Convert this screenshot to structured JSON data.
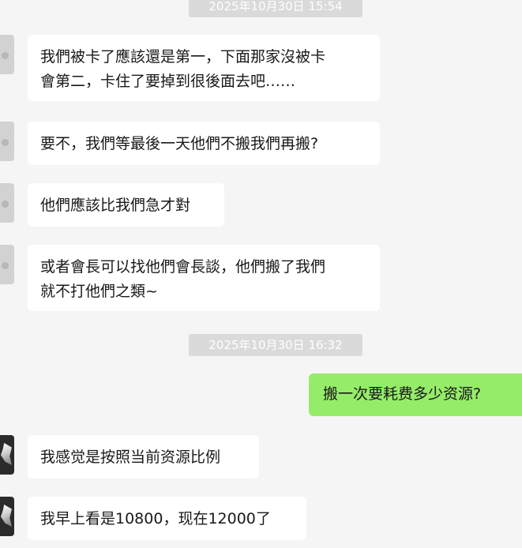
{
  "messages": [
    {
      "kind": "timestamp",
      "text": "2025年10月30日 15:54"
    },
    {
      "kind": "incoming",
      "avatar": "grey-avatar",
      "lines": [
        "我們被卡了應該還是第一，下面那家沒被卡",
        "會第二，卡住了要掉到很後面去吧……"
      ]
    },
    {
      "kind": "incoming",
      "avatar": "grey-avatar",
      "lines": [
        "要不，我們等最後一天他們不搬我們再搬?"
      ]
    },
    {
      "kind": "incoming",
      "avatar": "grey-avatar",
      "lines": [
        "他們應該比我們急才對"
      ]
    },
    {
      "kind": "incoming",
      "avatar": "grey-avatar",
      "lines": [
        "或者會長可以找他們會長談，他們搬了我們",
        "就不打他們之類~"
      ]
    },
    {
      "kind": "timestamp",
      "text": "2025年10月30日 16:32"
    },
    {
      "kind": "outgoing",
      "lines": [
        "搬一次要耗费多少资源?"
      ]
    },
    {
      "kind": "incoming",
      "avatar": "dark-avatar",
      "lines": [
        "我感觉是按照当前资源比例"
      ]
    },
    {
      "kind": "incoming",
      "avatar": "dark-avatar",
      "lines": [
        "我早上看是10800，现在12000了"
      ]
    }
  ],
  "colors": {
    "background": "#f5f5f5",
    "incoming_bubble": "#ffffff",
    "outgoing_bubble": "#95ec69",
    "timestamp_bg": "#dadada"
  }
}
